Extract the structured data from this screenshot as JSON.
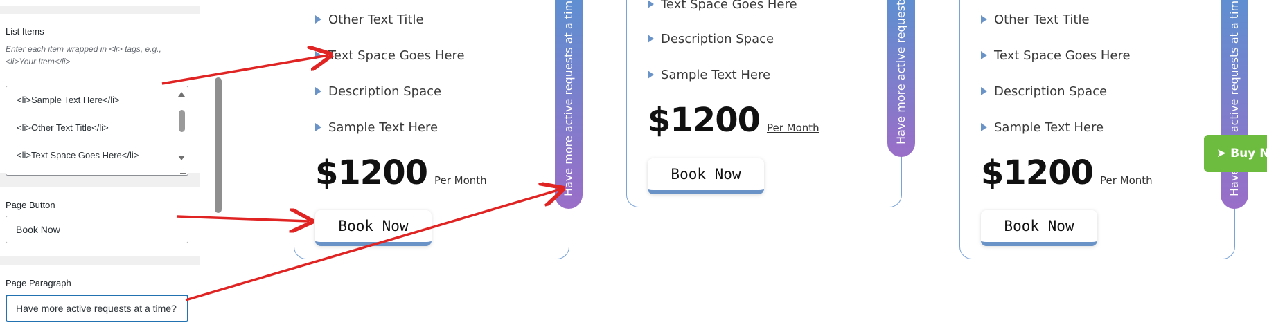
{
  "settings": {
    "list_items": {
      "label": "List Items",
      "help": "Enter each item wrapped in <li> tags, e.g., <li>Your Item</li>",
      "lines": [
        "<li>Sample Text Here</li>",
        "<li>Other Text Title</li>",
        "<li>Text Space Goes Here</li>"
      ]
    },
    "page_button": {
      "label": "Page Button",
      "value": "Book Now"
    },
    "page_paragraph": {
      "label": "Page Paragraph",
      "value": "Have more active requests at a time?"
    }
  },
  "cards": [
    {
      "items": [
        "Other Text Title",
        "Text Space Goes Here",
        "Description Space",
        "Sample Text Here"
      ],
      "price": "$1200",
      "period": "Per Month",
      "button": "Book Now",
      "tab": "Have more active requests at a time?"
    },
    {
      "items": [
        "Text Space Goes Here",
        "Description Space",
        "Sample Text Here"
      ],
      "price": "$1200",
      "period": "Per Month",
      "button": "Book Now",
      "tab": "Have more active requests at a time?"
    },
    {
      "items": [
        "Other Text Title",
        "Text Space Goes Here",
        "Description Space",
        "Sample Text Here"
      ],
      "price": "$1200",
      "period": "Per Month",
      "button": "Book Now",
      "tab": "Have more active requests at a time?"
    }
  ],
  "buy_button": {
    "label": "Buy N",
    "icon": "send-arrow-icon"
  },
  "annotation": {
    "color": "#e02424"
  },
  "colors": {
    "accent": "#6a93c8",
    "tab_gradient_start": "#5f8fd0",
    "tab_gradient_end": "#9a6ec8",
    "buy": "#6dbb3f"
  }
}
